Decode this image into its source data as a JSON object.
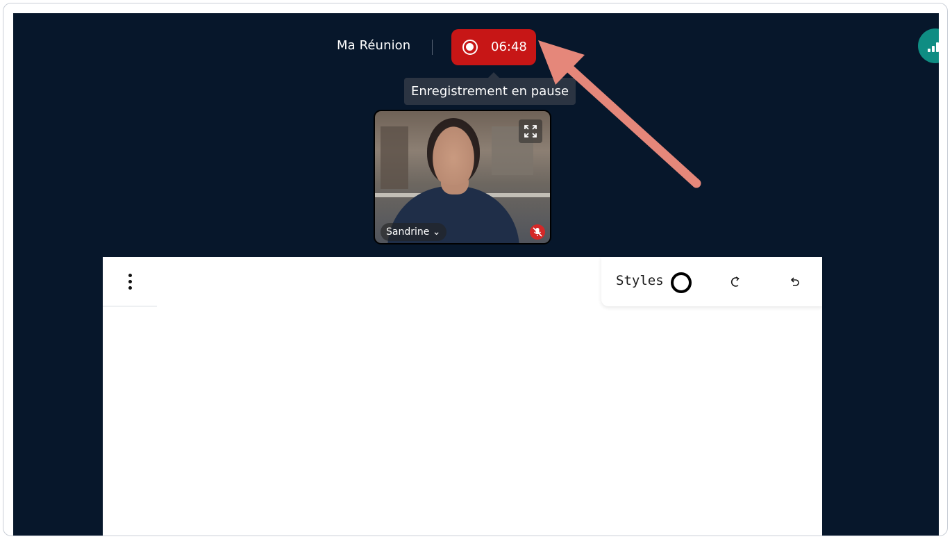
{
  "meeting": {
    "title": "Ma Réunion"
  },
  "recording": {
    "time": "06:48",
    "tooltip": "Enregistrement en pause",
    "pill_color": "#c71616"
  },
  "participant": {
    "name": "Sandrine",
    "name_suffix": " ⌄",
    "muted": true
  },
  "whiteboard": {
    "styles_label": "Styles",
    "icons": [
      "more-vertical-icon",
      "style-circle-icon",
      "redo-icon",
      "undo-icon"
    ]
  },
  "network_indicator": {
    "icon": "signal-bars-icon",
    "color": "#0f8d83"
  },
  "annotation": {
    "arrow_color": "#e5877a"
  },
  "colors": {
    "background": "#07172b",
    "mic_off": "#d42828"
  }
}
